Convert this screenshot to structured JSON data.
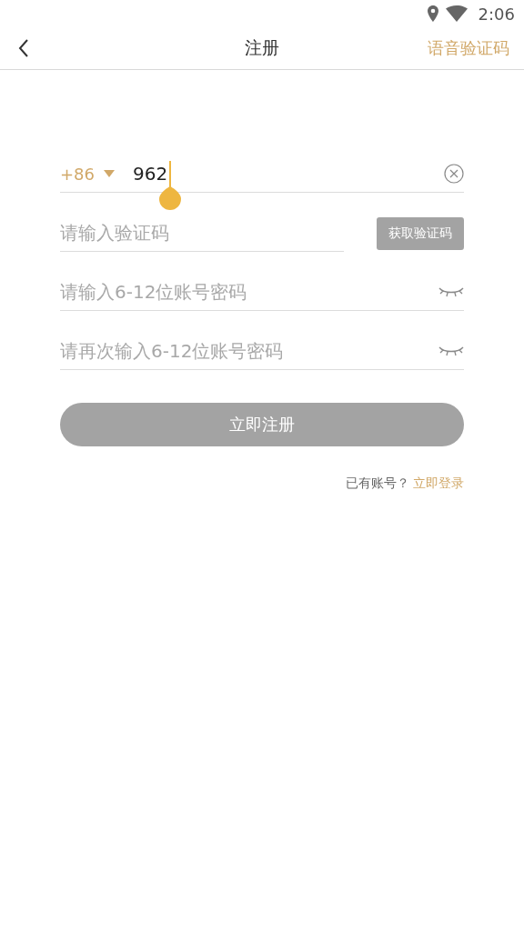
{
  "status_bar": {
    "time": "2:06"
  },
  "header": {
    "title": "注册",
    "action": "语音验证码"
  },
  "phone": {
    "country_code": "+86",
    "value": "962",
    "focused": true
  },
  "code": {
    "placeholder": "请输入验证码",
    "button": {
      "label": "获取验证码",
      "disabled": true
    }
  },
  "passwords": [
    {
      "placeholder": "请输入6-12位账号密码",
      "visible": false
    },
    {
      "placeholder": "请再次输入6-12位账号密码",
      "visible": false
    }
  ],
  "register_button": {
    "label": "立即注册",
    "disabled": true
  },
  "login": {
    "prompt": "已有账号？",
    "link": "立即登录"
  }
}
